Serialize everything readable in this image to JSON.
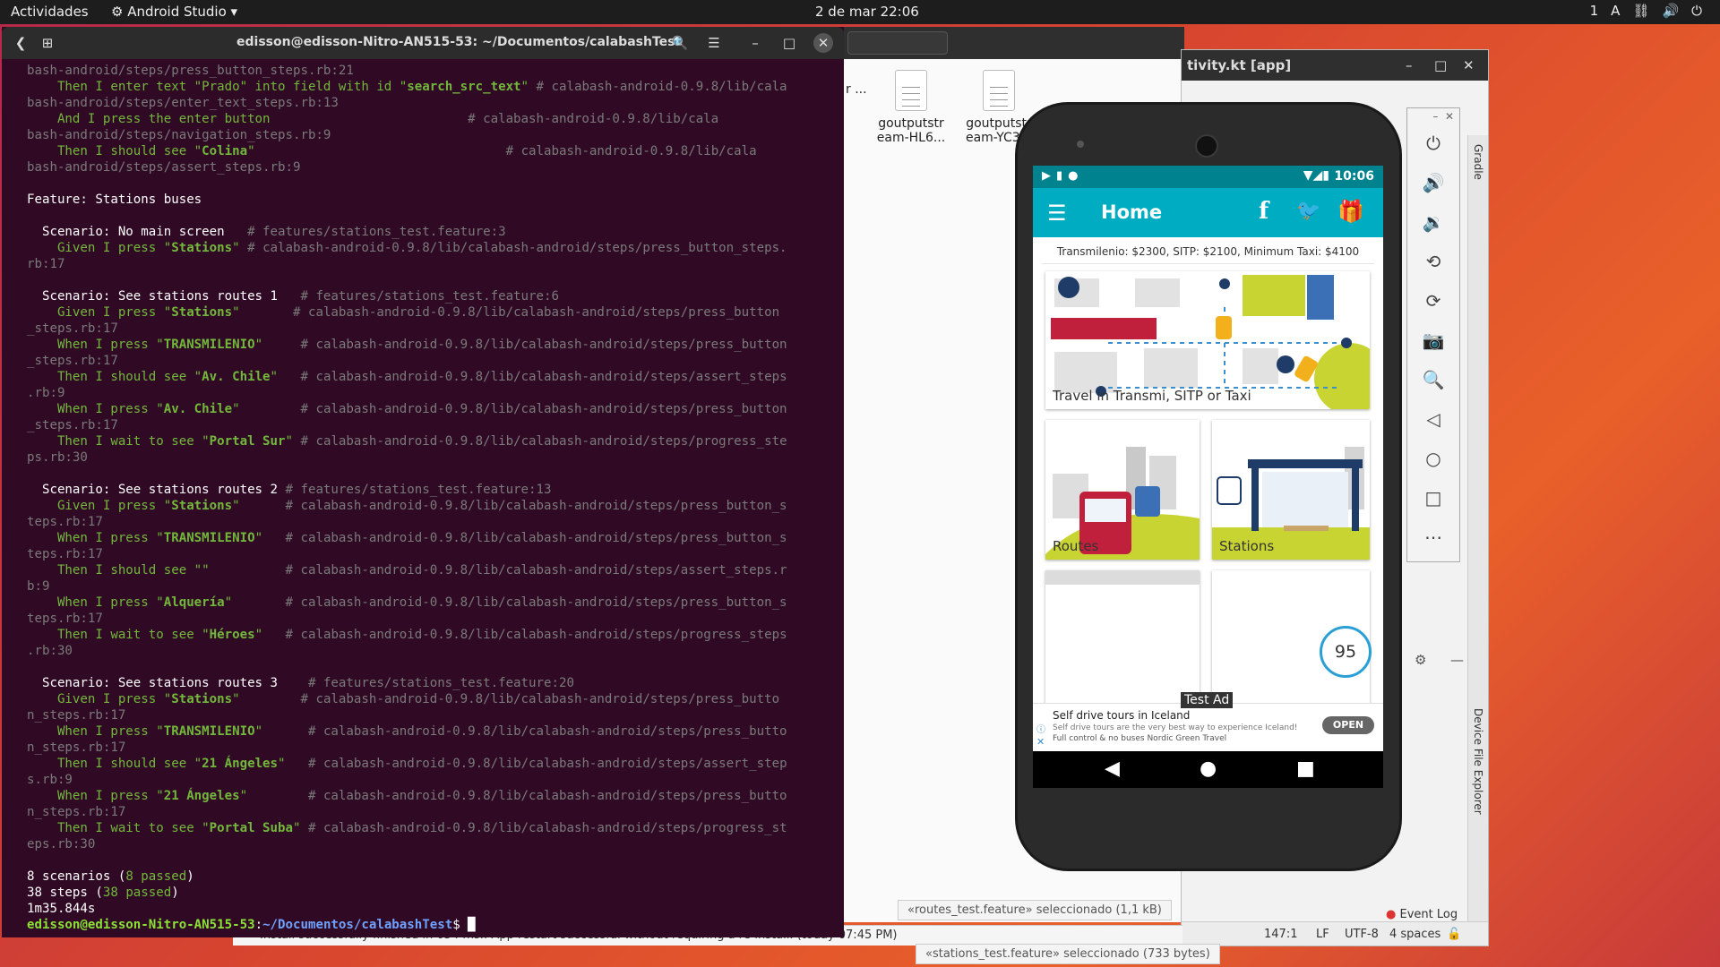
{
  "topbar": {
    "activities": "Actividades",
    "app_menu": "Android Studio",
    "datetime": "2 de mar  22:06",
    "tray": [
      "1",
      "A",
      "⛓",
      "🔊",
      "⏻"
    ]
  },
  "terminal": {
    "title": "edisson@edisson-Nitro-AN515-53: ~/Documentos/calabashTest",
    "lines": [
      [
        [
          "gr",
          "bash-android/steps/press_button_steps.rb:21"
        ]
      ],
      [
        [
          "g",
          "    Then I enter text \"Prado\" into field with id \""
        ],
        [
          "s",
          "search_src_text"
        ],
        [
          "g",
          "\" "
        ],
        [
          "gr",
          "# calabash-android-0.9.8/lib/cala"
        ]
      ],
      [
        [
          "gr",
          "bash-android/steps/enter_text_steps.rb:13"
        ]
      ],
      [
        [
          "g",
          "    And I press the enter button                          "
        ],
        [
          "gr",
          "# calabash-android-0.9.8/lib/cala"
        ]
      ],
      [
        [
          "gr",
          "bash-android/steps/navigation_steps.rb:9"
        ]
      ],
      [
        [
          "g",
          "    Then I should see \""
        ],
        [
          "s",
          "Colina"
        ],
        [
          "g",
          "\"                                 "
        ],
        [
          "gr",
          "# calabash-android-0.9.8/lib/cala"
        ]
      ],
      [
        [
          "gr",
          "bash-android/steps/assert_steps.rb:9"
        ]
      ],
      [
        [
          "w",
          ""
        ]
      ],
      [
        [
          "w",
          "Feature: Stations buses"
        ]
      ],
      [
        [
          "w",
          ""
        ]
      ],
      [
        [
          "w",
          "  Scenario: No main screen   "
        ],
        [
          "gr",
          "# features/stations_test.feature:3"
        ]
      ],
      [
        [
          "g",
          "    Given I press \""
        ],
        [
          "s",
          "Stations"
        ],
        [
          "g",
          "\" "
        ],
        [
          "gr",
          "# calabash-android-0.9.8/lib/calabash-android/steps/press_button_steps."
        ]
      ],
      [
        [
          "gr",
          "rb:17"
        ]
      ],
      [
        [
          "w",
          ""
        ]
      ],
      [
        [
          "w",
          "  Scenario: See stations routes 1   "
        ],
        [
          "gr",
          "# features/stations_test.feature:6"
        ]
      ],
      [
        [
          "g",
          "    Given I press \""
        ],
        [
          "s",
          "Stations"
        ],
        [
          "g",
          "\"       "
        ],
        [
          "gr",
          "# calabash-android-0.9.8/lib/calabash-android/steps/press_button"
        ]
      ],
      [
        [
          "gr",
          "_steps.rb:17"
        ]
      ],
      [
        [
          "g",
          "    When I press \""
        ],
        [
          "s",
          "TRANSMILENIO"
        ],
        [
          "g",
          "\"     "
        ],
        [
          "gr",
          "# calabash-android-0.9.8/lib/calabash-android/steps/press_button"
        ]
      ],
      [
        [
          "gr",
          "_steps.rb:17"
        ]
      ],
      [
        [
          "g",
          "    Then I should see \""
        ],
        [
          "s",
          "Av. Chile"
        ],
        [
          "g",
          "\"   "
        ],
        [
          "gr",
          "# calabash-android-0.9.8/lib/calabash-android/steps/assert_steps"
        ]
      ],
      [
        [
          "gr",
          ".rb:9"
        ]
      ],
      [
        [
          "g",
          "    When I press \""
        ],
        [
          "s",
          "Av. Chile"
        ],
        [
          "g",
          "\"        "
        ],
        [
          "gr",
          "# calabash-android-0.9.8/lib/calabash-android/steps/press_button"
        ]
      ],
      [
        [
          "gr",
          "_steps.rb:17"
        ]
      ],
      [
        [
          "g",
          "    Then I wait to see \""
        ],
        [
          "s",
          "Portal Sur"
        ],
        [
          "g",
          "\" "
        ],
        [
          "gr",
          "# calabash-android-0.9.8/lib/calabash-android/steps/progress_ste"
        ]
      ],
      [
        [
          "gr",
          "ps.rb:30"
        ]
      ],
      [
        [
          "w",
          ""
        ]
      ],
      [
        [
          "w",
          "  Scenario: See stations routes 2 "
        ],
        [
          "gr",
          "# features/stations_test.feature:13"
        ]
      ],
      [
        [
          "g",
          "    Given I press \""
        ],
        [
          "s",
          "Stations"
        ],
        [
          "g",
          "\"      "
        ],
        [
          "gr",
          "# calabash-android-0.9.8/lib/calabash-android/steps/press_button_s"
        ]
      ],
      [
        [
          "gr",
          "teps.rb:17"
        ]
      ],
      [
        [
          "g",
          "    When I press \""
        ],
        [
          "s",
          "TRANSMILENIO"
        ],
        [
          "g",
          "\"   "
        ],
        [
          "gr",
          "# calabash-android-0.9.8/lib/calabash-android/steps/press_button_s"
        ]
      ],
      [
        [
          "gr",
          "teps.rb:17"
        ]
      ],
      [
        [
          "g",
          "    Then I should see \"\"          "
        ],
        [
          "gr",
          "# calabash-android-0.9.8/lib/calabash-android/steps/assert_steps.r"
        ]
      ],
      [
        [
          "gr",
          "b:9"
        ]
      ],
      [
        [
          "g",
          "    When I press \""
        ],
        [
          "s",
          "Alquería"
        ],
        [
          "g",
          "\"       "
        ],
        [
          "gr",
          "# calabash-android-0.9.8/lib/calabash-android/steps/press_button_s"
        ]
      ],
      [
        [
          "gr",
          "teps.rb:17"
        ]
      ],
      [
        [
          "g",
          "    Then I wait to see \""
        ],
        [
          "s",
          "Héroes"
        ],
        [
          "g",
          "\"   "
        ],
        [
          "gr",
          "# calabash-android-0.9.8/lib/calabash-android/steps/progress_steps"
        ]
      ],
      [
        [
          "gr",
          ".rb:30"
        ]
      ],
      [
        [
          "w",
          ""
        ]
      ],
      [
        [
          "w",
          "  Scenario: See stations routes 3    "
        ],
        [
          "gr",
          "# features/stations_test.feature:20"
        ]
      ],
      [
        [
          "g",
          "    Given I press \""
        ],
        [
          "s",
          "Stations"
        ],
        [
          "g",
          "\"        "
        ],
        [
          "gr",
          "# calabash-android-0.9.8/lib/calabash-android/steps/press_butto"
        ]
      ],
      [
        [
          "gr",
          "n_steps.rb:17"
        ]
      ],
      [
        [
          "g",
          "    When I press \""
        ],
        [
          "s",
          "TRANSMILENIO"
        ],
        [
          "g",
          "\"      "
        ],
        [
          "gr",
          "# calabash-android-0.9.8/lib/calabash-android/steps/press_butto"
        ]
      ],
      [
        [
          "gr",
          "n_steps.rb:17"
        ]
      ],
      [
        [
          "g",
          "    Then I should see \""
        ],
        [
          "s",
          "21 Ángeles"
        ],
        [
          "g",
          "\"   "
        ],
        [
          "gr",
          "# calabash-android-0.9.8/lib/calabash-android/steps/assert_step"
        ]
      ],
      [
        [
          "gr",
          "s.rb:9"
        ]
      ],
      [
        [
          "g",
          "    When I press \""
        ],
        [
          "s",
          "21 Ángeles"
        ],
        [
          "g",
          "\"        "
        ],
        [
          "gr",
          "# calabash-android-0.9.8/lib/calabash-android/steps/press_butto"
        ]
      ],
      [
        [
          "gr",
          "n_steps.rb:17"
        ]
      ],
      [
        [
          "g",
          "    Then I wait to see \""
        ],
        [
          "s",
          "Portal Suba"
        ],
        [
          "g",
          "\" "
        ],
        [
          "gr",
          "# calabash-android-0.9.8/lib/calabash-android/steps/progress_st"
        ]
      ],
      [
        [
          "gr",
          "eps.rb:30"
        ]
      ],
      [
        [
          "w",
          ""
        ]
      ],
      [
        [
          "w",
          "8 scenarios ("
        ],
        [
          "g",
          "8 passed"
        ],
        [
          "w",
          ")"
        ]
      ],
      [
        [
          "w",
          "38 steps ("
        ],
        [
          "g",
          "38 passed"
        ],
        [
          "w",
          ")"
        ]
      ],
      [
        [
          "w",
          "1m35.844s"
        ]
      ],
      [
        [
          "gb",
          "edisson@edisson-Nitro-AN515-53"
        ],
        [
          "w",
          ":"
        ],
        [
          "b",
          "~/Documentos/calabashTest"
        ],
        [
          "w",
          "$ █"
        ]
      ]
    ]
  },
  "files": {
    "items": [
      {
        "name": "goutputstr eam-HL6..."
      },
      {
        "name": "goutputstr eam-YC3..."
      }
    ],
    "partial_item": "r ...",
    "status": "«routes_test.feature» seleccionado (1,1 kB)",
    "status2": "«stations_test.feature» seleccionado (733 bytes)"
  },
  "studio": {
    "title": "tivity.kt [app]",
    "gradle": "Gradle",
    "device_explorer": "Device File Explorer",
    "event_log": "Event Log",
    "position": "147:1",
    "line_ending": "LF",
    "encoding": "UTF-8",
    "indent": "4 spaces",
    "build_msg": "Install successfully finished in 654 ms.: App restart successful without requiring a re-install. (today 07:45 PM)"
  },
  "emulator_toolbar": [
    "power-icon",
    "volume-up-icon",
    "volume-down-icon",
    "rotate-left-icon",
    "rotate-right-icon",
    "camera-icon",
    "zoom-icon",
    "back-icon",
    "home-icon",
    "overview-icon",
    "more-icon"
  ],
  "phone": {
    "time": "10:06",
    "app_title": "Home",
    "fares": "Transmilenio: $2300, SITP: $2100, Minimum Taxi: $4100",
    "cards": {
      "travel": "Travel in Transmi, SITP or Taxi",
      "routes": "Routes",
      "stations": "Stations"
    },
    "badge": "95",
    "ad": {
      "title": "Self drive tours in Iceland",
      "line1": "Self drive tours are the very best way to experience Iceland!",
      "line2": "Full control & no buses Nordic Green Travel",
      "button": "OPEN",
      "test_label": "Test Ad"
    }
  }
}
